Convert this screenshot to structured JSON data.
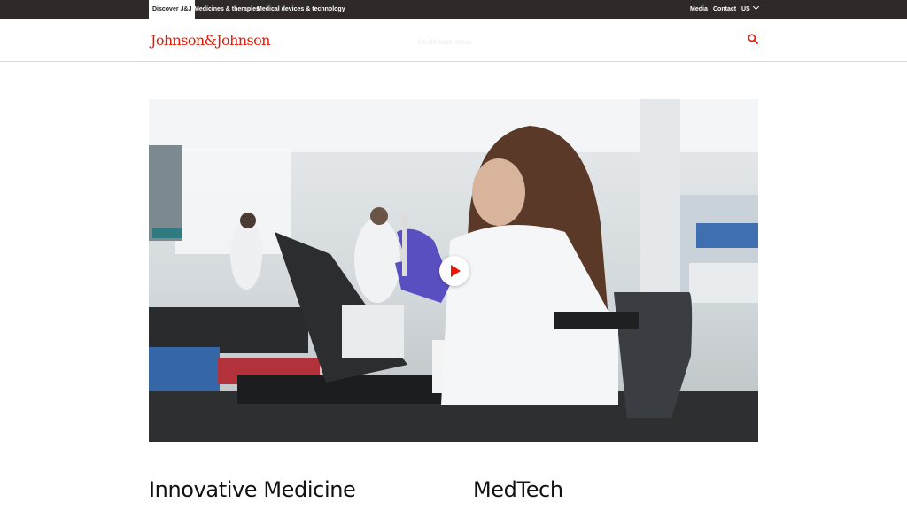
{
  "topbar": {
    "tabs": [
      "Discover J&J",
      "Medicines & therapies",
      "Medical devices & technology"
    ],
    "media": "Media",
    "contact": "Contact",
    "region": "US"
  },
  "header": {
    "logo": "Johnson&Johnson",
    "nav": "Healthcare areas"
  },
  "hero": {
    "media": "video",
    "play_icon": "play-icon"
  },
  "sections": [
    "Innovative Medicine",
    "MedTech"
  ],
  "colors": {
    "brand_red": "#eb1700",
    "topbar_bg": "#2f2a28"
  }
}
